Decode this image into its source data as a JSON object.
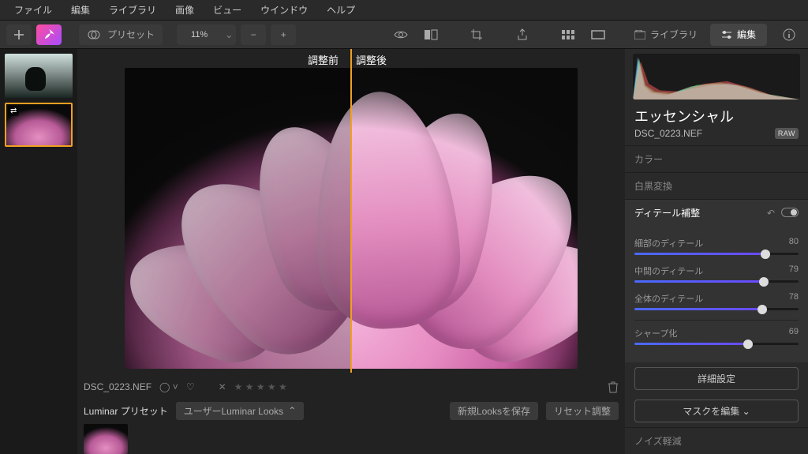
{
  "menu": {
    "items": [
      "ファイル",
      "編集",
      "ライブラリ",
      "画像",
      "ビュー",
      "ウインドウ",
      "ヘルプ"
    ]
  },
  "toolbar": {
    "preset_label": "プリセット",
    "zoom": "11%"
  },
  "modes": {
    "library": "ライブラリ",
    "edit": "編集"
  },
  "compare": {
    "before": "調整前",
    "after": "調整後"
  },
  "footer": {
    "filename": "DSC_0223.NEF",
    "preset_title": "Luminar プリセット",
    "preset_group": "ユーザーLuminar Looks",
    "save_look": "新規Looksを保存",
    "reset": "リセット調整"
  },
  "panel": {
    "title": "エッセンシャル",
    "file": "DSC_0223.NEF",
    "badge": "RAW",
    "sections": {
      "color": "カラー",
      "bw": "白黒変換",
      "detail": "ディテール補整",
      "noise": "ノイズ軽減"
    },
    "sliders": {
      "small": {
        "label": "細部のディテール",
        "value": 80
      },
      "medium": {
        "label": "中間のディテール",
        "value": 79
      },
      "large": {
        "label": "全体のディテール",
        "value": 78
      },
      "sharpen": {
        "label": "シャープ化",
        "value": 69
      }
    },
    "buttons": {
      "advanced": "詳細設定",
      "mask": "マスクを編集"
    }
  }
}
